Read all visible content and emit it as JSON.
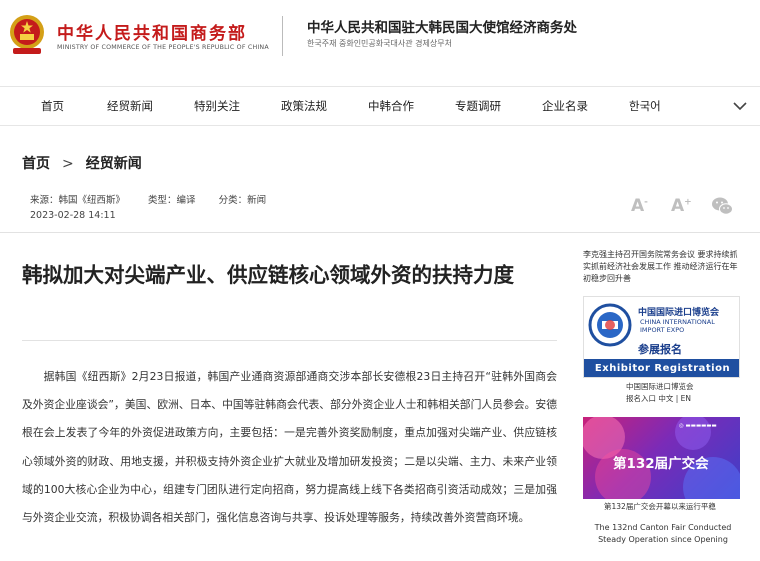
{
  "header": {
    "ministry_cn": "中华人民共和国商务部",
    "ministry_en": "MINISTRY OF COMMERCE OF THE PEOPLE'S REPUBLIC OF CHINA",
    "embassy_cn": "中华人民共和国驻大韩民国大使馆经济商务处",
    "embassy_kr": "한국주재 중화인민공화국대사관 경제상무처"
  },
  "nav": {
    "items": [
      "首页",
      "经贸新闻",
      "特别关注",
      "政策法规",
      "中韩合作",
      "专题调研",
      "企业名录",
      "한국어"
    ]
  },
  "breadcrumb": {
    "home": "首页",
    "sep": ">",
    "section": "经贸新闻"
  },
  "article": {
    "source": "来源：韩国《纽西斯》",
    "type": "类型：编译",
    "category": "分类：新闻",
    "date": "2023-02-28 14:11",
    "title": "韩拟加大对尖端产业、供应链核心领域外资的扶持力度",
    "body": "据韩国《纽西斯》2月23日报道，韩国产业通商资源部通商交涉本部长安德根23日主持召开“驻韩外国商会及外资企业座谈会”，美国、欧洲、日本、中国等驻韩商会代表、部分外资企业人士和韩相关部门人员参会。安德根在会上发表了今年的外资促进政策方向，主要包括：一是完善外资奖励制度，重点加强对尖端产业、供应链核心领域外资的财政、用地支援，并积极支持外资企业扩大就业及增加研发投资；二是以尖端、主力、未来产业领域的100大核心企业为中心，组建专门团队进行定向招商，努力提高线上线下各类招商引资活动成效；三是加强与外资企业交流，积极协调各相关部门，强化信息咨询与共享、投诉处理等服务，持续改善外资营商环境。"
  },
  "tools": {
    "font_decrease": "A",
    "font_increase": "A",
    "minus": "-",
    "plus": "+"
  },
  "sidebar": {
    "news_text": "李克强主持召开国务院常务会议 要求持续抓实抓前经济社会发展工作 推动经济运行在年初稳步回升善",
    "ciie": {
      "cn": "中国国际进口博览会",
      "en": "CHINA INTERNATIONAL IMPORT EXPO",
      "reg_cn": "参展报名",
      "reg_en": "Exhibitor Registration",
      "caption": "中国国际进口博览会",
      "links": "报名入口 中文 | EN"
    },
    "canton": {
      "banner_text": "第132届广交会",
      "caption": "第132届广交会开幕以来运行平稳",
      "en": "The 132nd Canton Fair Conducted Steady Operation since Opening"
    }
  },
  "colors": {
    "brand_red": "#c41b1b",
    "ciie_blue": "#1f4fa0"
  }
}
